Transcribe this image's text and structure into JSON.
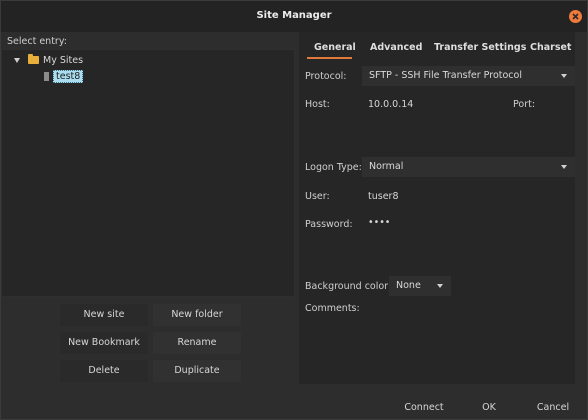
{
  "window": {
    "title": "Site Manager"
  },
  "left": {
    "select_label": "Select entry:",
    "tree": {
      "folder_label": "My Sites",
      "site_label": "test8"
    },
    "buttons": {
      "new_site": "New site",
      "new_folder": "New folder",
      "new_bookmark": "New Bookmark",
      "rename": "Rename",
      "delete": "Delete",
      "duplicate": "Duplicate"
    }
  },
  "tabs": [
    "General",
    "Advanced",
    "Transfer Settings",
    "Charset"
  ],
  "general": {
    "protocol_label": "Protocol:",
    "protocol_value": "SFTP - SSH File Transfer Protocol",
    "host_label": "Host:",
    "host_value": "10.0.0.14",
    "port_label": "Port:",
    "logon_type_label": "Logon Type:",
    "logon_type_value": "Normal",
    "user_label": "User:",
    "user_value": "tuser8",
    "password_label": "Password:",
    "password_value": "••••",
    "background_label": "Background color:",
    "background_value": "None",
    "comments_label": "Comments:"
  },
  "footer": {
    "connect": "Connect",
    "ok": "OK",
    "cancel": "Cancel"
  }
}
